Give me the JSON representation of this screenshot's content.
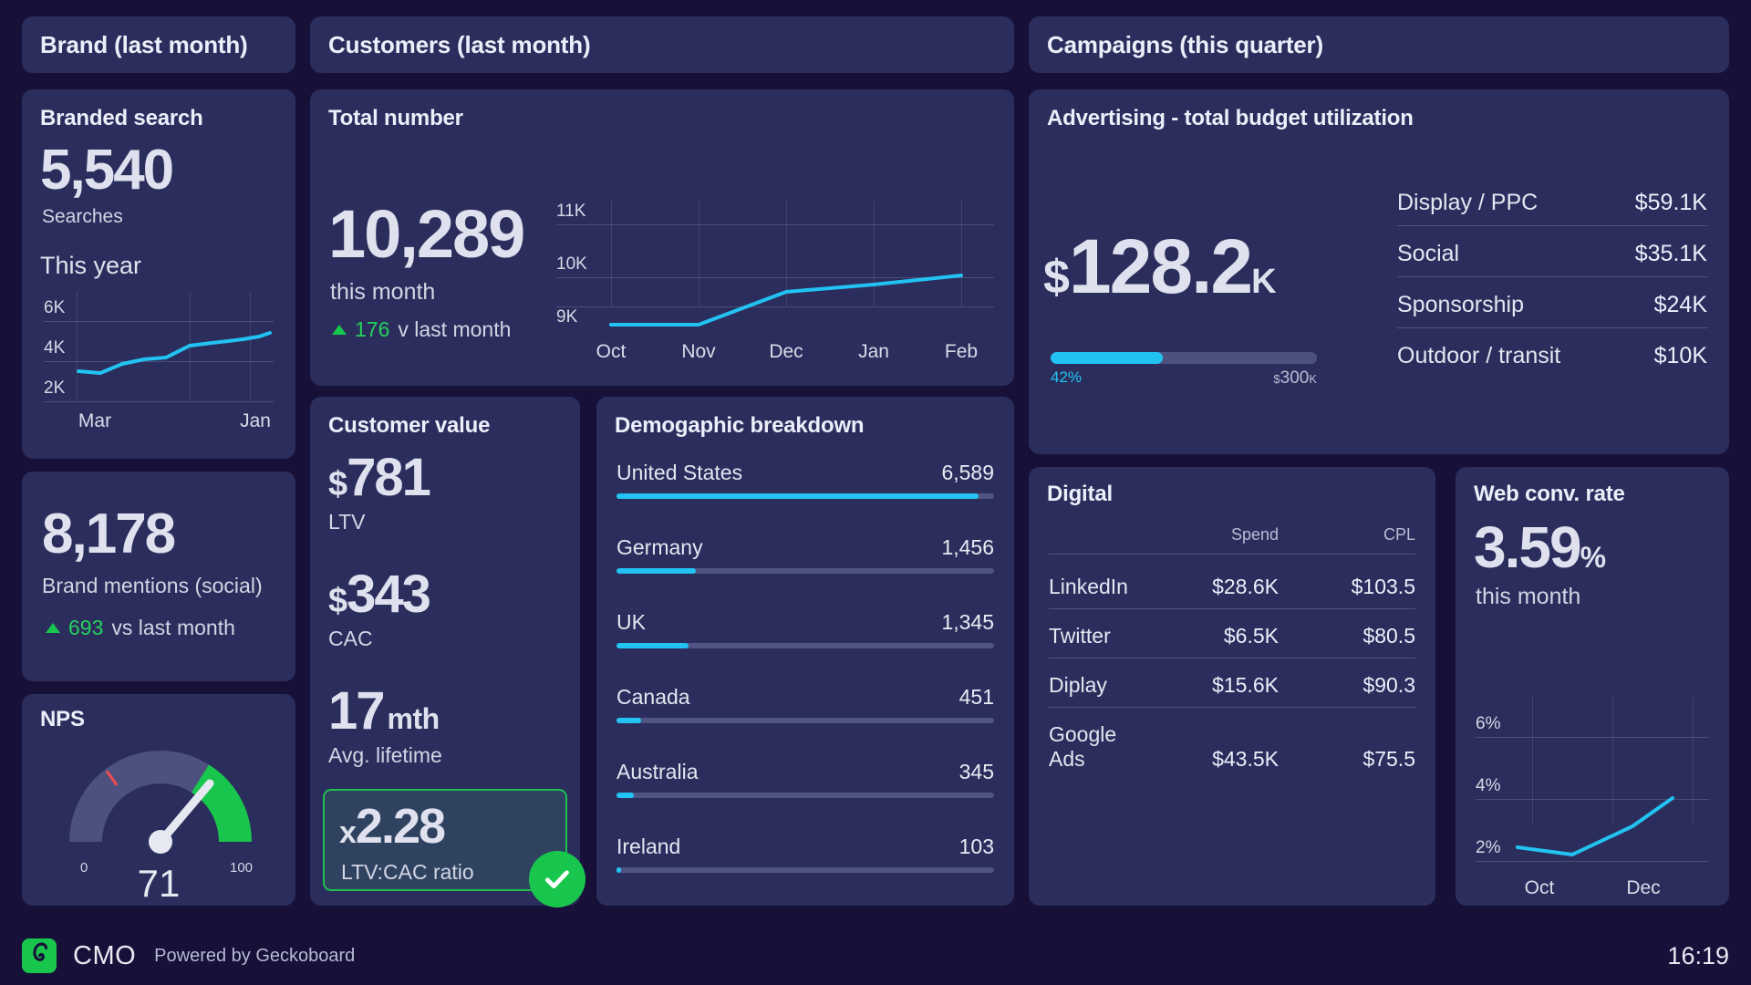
{
  "sections": [
    {
      "id": "brand",
      "title": "Brand (last month)"
    },
    {
      "id": "customers",
      "title": "Customers (last month)"
    },
    {
      "id": "campaigns",
      "title": "Campaigns (this quarter)"
    }
  ],
  "branded_search": {
    "title": "Branded search",
    "value": "5,540",
    "label": "Searches",
    "chart_label": "This year"
  },
  "brand_mentions": {
    "value": "8,178",
    "label": "Brand mentions (social)",
    "delta_value": "693",
    "delta_text": "vs last month",
    "delta_direction": "up"
  },
  "nps": {
    "title": "NPS",
    "value": "71",
    "min_label": "0",
    "max_label": "100",
    "min": 0,
    "max": 100,
    "target": 33,
    "good_from": 73
  },
  "total_number": {
    "title": "Total number",
    "value": "10,289",
    "label": "this month",
    "delta_value": "176",
    "delta_text": "v last month",
    "delta_direction": "up"
  },
  "customer_value": {
    "title": "Customer value",
    "metrics": [
      {
        "prefix": "$",
        "value": "781",
        "suffix": "",
        "label": "LTV"
      },
      {
        "prefix": "$",
        "value": "343",
        "suffix": "",
        "label": "CAC"
      },
      {
        "prefix": "",
        "value": "17",
        "suffix": "mth",
        "label": "Avg. lifetime"
      }
    ],
    "ratio": {
      "prefix": "x",
      "value": "2.28",
      "label": "LTV:CAC ratio",
      "status": "good"
    }
  },
  "demographics": {
    "title": "Demogaphic breakdown",
    "rows": [
      {
        "label": "United States",
        "value": "6,589",
        "pct": 100
      },
      {
        "label": "Germany",
        "value": "1,456",
        "pct": 22
      },
      {
        "label": "UK",
        "value": "1,345",
        "pct": 20.4
      },
      {
        "label": "Canada",
        "value": "451",
        "pct": 6.8
      },
      {
        "label": "Australia",
        "value": "345",
        "pct": 5.2
      },
      {
        "label": "Ireland",
        "value": "103",
        "pct": 1.6
      }
    ]
  },
  "advertising": {
    "title": "Advertising - total budget utilization",
    "currency": "$",
    "amount": "128.2",
    "unit": "K",
    "progress_pct": 42,
    "progress_label": "42%",
    "budget_currency": "$",
    "budget_label": "300",
    "budget_unit": "K",
    "rows": [
      {
        "label": "Display / PPC",
        "value": "$59.1K"
      },
      {
        "label": "Social",
        "value": "$35.1K"
      },
      {
        "label": "Sponsorship",
        "value": "$24K"
      },
      {
        "label": "Outdoor / transit",
        "value": "$10K"
      }
    ]
  },
  "digital": {
    "title": "Digital",
    "columns": [
      "",
      "Spend",
      "CPL"
    ],
    "rows": [
      {
        "channel": "LinkedIn",
        "spend": "$28.6K",
        "cpl": "$103.5"
      },
      {
        "channel": "Twitter",
        "spend": "$6.5K",
        "cpl": "$80.5"
      },
      {
        "channel": "Diplay",
        "spend": "$15.6K",
        "cpl": "$90.3"
      },
      {
        "channel": "Google Ads",
        "spend": "$43.5K",
        "cpl": "$75.5"
      }
    ]
  },
  "web_conv": {
    "title": "Web conv. rate",
    "value": "3.59",
    "unit": "%",
    "label": "this month"
  },
  "footer": {
    "brand": "CMO",
    "powered_by": "Powered by Geckoboard",
    "clock": "16:19"
  },
  "colors": {
    "background": "#171038",
    "panel": "#2b2e5c",
    "accent_cyan": "#22c3f2",
    "accent_green": "#19c64d",
    "text": "#e2e4ef"
  },
  "chart_data": [
    {
      "id": "branded-search-sparkline",
      "type": "line",
      "title": "This year",
      "x": [
        "Mar",
        "Apr",
        "May",
        "Jun",
        "Jul",
        "Aug",
        "Sep",
        "Oct",
        "Nov",
        "Dec",
        "Jan"
      ],
      "xtick_labels": [
        "Mar",
        "Jan"
      ],
      "values": [
        3500,
        3450,
        3700,
        3850,
        3900,
        4350,
        4450,
        4500,
        4560,
        4650,
        4800
      ],
      "ylabel": "",
      "ytick_labels": [
        "6K",
        "4K",
        "2K"
      ],
      "yticks": [
        6000,
        4000,
        2000
      ],
      "ylim": [
        1000,
        7000
      ],
      "grid": true,
      "color": "#22c3f2"
    },
    {
      "id": "total-number-line",
      "type": "line",
      "title": "",
      "x": [
        "Oct",
        "Nov",
        "Dec",
        "Jan",
        "Feb"
      ],
      "values": [
        9150,
        9150,
        9750,
        9880,
        10050
      ],
      "ytick_labels": [
        "11K",
        "10K",
        "9K"
      ],
      "yticks": [
        11000,
        10000,
        9000
      ],
      "ylim": [
        8600,
        11400
      ],
      "grid": true,
      "color": "#22c3f2"
    },
    {
      "id": "web-conv-rate-line",
      "type": "line",
      "title": "Web conv. rate",
      "x": [
        "Oct",
        "Nov",
        "Dec",
        "Jan"
      ],
      "xtick_labels": [
        "Oct",
        "Dec"
      ],
      "values": [
        2.55,
        2.3,
        3.2,
        3.9
      ],
      "ytick_labels": [
        "6%",
        "4%",
        "2%"
      ],
      "yticks": [
        6,
        4,
        2
      ],
      "ylim": [
        1.4,
        6.8
      ],
      "grid": true,
      "color": "#22c3f2"
    },
    {
      "id": "nps-gauge",
      "type": "gauge",
      "title": "NPS",
      "value": 71,
      "min": 0,
      "max": 100,
      "target": 33,
      "bands": [
        {
          "from": 0,
          "to": 73,
          "color": "#4d5180"
        },
        {
          "from": 73,
          "to": 100,
          "color": "#19c64d"
        }
      ]
    },
    {
      "id": "demographic-bars",
      "type": "bar",
      "title": "Demogaphic breakdown",
      "orientation": "horizontal",
      "categories": [
        "United States",
        "Germany",
        "UK",
        "Canada",
        "Australia",
        "Ireland"
      ],
      "values": [
        6589,
        1456,
        1345,
        451,
        345,
        103
      ],
      "color": "#22c3f2"
    },
    {
      "id": "budget-utilization",
      "type": "bar",
      "title": "Advertising - total budget utilization",
      "categories": [
        "Display / PPC",
        "Social",
        "Sponsorship",
        "Outdoor / transit"
      ],
      "values": [
        59100,
        35100,
        24000,
        10000
      ],
      "total": 128200,
      "budget": 300000,
      "utilization_pct": 42
    },
    {
      "id": "digital-table",
      "type": "table",
      "title": "Digital",
      "columns": [
        "",
        "Spend",
        "CPL"
      ],
      "rows": [
        [
          "LinkedIn",
          "$28.6K",
          "$103.5"
        ],
        [
          "Twitter",
          "$6.5K",
          "$80.5"
        ],
        [
          "Diplay",
          "$15.6K",
          "$90.3"
        ],
        [
          "Google Ads",
          "$43.5K",
          "$75.5"
        ]
      ]
    }
  ]
}
